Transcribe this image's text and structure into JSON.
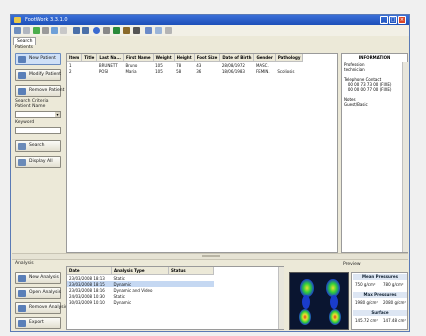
{
  "window": {
    "title": "FootWork 3.3.1.0",
    "minimize": "_",
    "maximize": "□",
    "close": "×"
  },
  "tabs": [
    {
      "label": "Search"
    }
  ],
  "patients": {
    "header": "Patients",
    "buttons": {
      "new": "New Patient",
      "modify": "Modify Patient",
      "remove": "Remove Patient",
      "search": "Search",
      "display_all": "Display All"
    },
    "search_criteria_label": "Search Criteria",
    "patient_name_label": "Patient Name",
    "keyword_label": "Keyword",
    "columns": [
      "Item",
      "Title",
      "Last Na...",
      "First Name",
      "Weight",
      "Height",
      "Foot Size",
      "Date of Birth",
      "Gender",
      "Pathology"
    ],
    "rows": [
      [
        "1",
        "",
        "BRUNETT",
        "Bruno",
        "105",
        "78",
        "43",
        "28/08/1972",
        "MASC.",
        ""
      ],
      [
        "2",
        "",
        "POSI",
        "Maria",
        "105",
        "58",
        "36",
        "18/06/1983",
        "FEMIN.",
        "Scoliosis"
      ]
    ]
  },
  "info": {
    "title": "INFORMATION",
    "lines": [
      "Profession",
      "technician",
      "",
      "Telephone Contact",
      "   00 00 73 73 00 (FIXE)",
      "   00 00 00 77 00 (FIXE)",
      "",
      "Notes",
      "Guest/Basic"
    ]
  },
  "analysis": {
    "header": "Analysis",
    "buttons": {
      "new": "New Analysis",
      "open": "Open Analysis",
      "remove": "Remove Analysis",
      "export": "Export"
    },
    "columns": [
      "Date",
      "Analysis Type",
      "Status"
    ],
    "rows": [
      [
        "23/03/2008 18:13",
        "Static",
        ""
      ],
      [
        "23/03/2008 18:15",
        "Dynamic",
        ""
      ],
      [
        "23/03/2008 18:16",
        "Dynamic and Video",
        ""
      ],
      [
        "24/03/2008 10:30",
        "Static",
        ""
      ],
      [
        "30/03/2009 10:10",
        "Dynamic",
        ""
      ]
    ],
    "selected_row": 1
  },
  "preview": {
    "title": "Preview",
    "mean_pressures": {
      "label": "Mean Pressures",
      "left": "750 g/cm²",
      "right": "780 g/cm²"
    },
    "max_pressures": {
      "label": "Max Pressures",
      "left": "1980 g/cm²",
      "right": "2080 g/cm²"
    },
    "surface": {
      "label": "Surface",
      "left": "145.72 cm²",
      "right": "147.48 cm²"
    }
  },
  "colors": {
    "titlebar": "#1c4fb8",
    "selection": "#c5d8f2",
    "heat_low": "#1a3ccc",
    "heat_mid": "#2fcf3a",
    "heat_high": "#e8e030",
    "heat_peak": "#e33c1c"
  }
}
